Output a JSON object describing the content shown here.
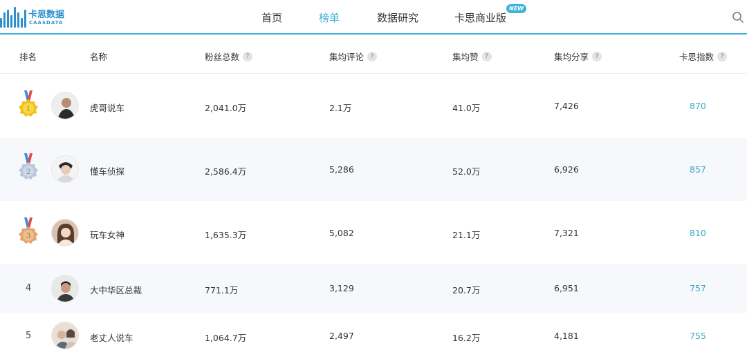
{
  "brand": {
    "name_cn": "卡思数据",
    "name_en": "CAASDATA",
    "color": "#2b8fd0"
  },
  "nav": {
    "items": [
      {
        "label": "首页",
        "active": false
      },
      {
        "label": "榜单",
        "active": true
      },
      {
        "label": "数据研究",
        "active": false
      },
      {
        "label": "卡思商业版",
        "active": false
      }
    ],
    "new_badge": "NEW",
    "accent": "#3fb2d7"
  },
  "table": {
    "columns": [
      "排名",
      "名称",
      "粉丝总数",
      "集均评论",
      "集均赞",
      "集均分享",
      "卡思指数"
    ],
    "help_icon": "?",
    "rows": [
      {
        "rank": "1",
        "medal": "gold",
        "name": "虎哥说车",
        "fans": "2,041.0万",
        "comments": "2.1万",
        "likes": "41.0万",
        "shares": "7,426",
        "index": "870"
      },
      {
        "rank": "2",
        "medal": "silver",
        "name": "懂车侦探",
        "fans": "2,586.4万",
        "comments": "5,286",
        "likes": "52.0万",
        "shares": "6,926",
        "index": "857"
      },
      {
        "rank": "3",
        "medal": "bronze",
        "name": "玩车女神",
        "fans": "1,635.3万",
        "comments": "5,082",
        "likes": "21.1万",
        "shares": "7,321",
        "index": "810"
      },
      {
        "rank": "4",
        "medal": "",
        "name": "大中华区总裁",
        "fans": "771.1万",
        "comments": "3,129",
        "likes": "20.7万",
        "shares": "6,951",
        "index": "757"
      },
      {
        "rank": "5",
        "medal": "",
        "name": "老丈人说车",
        "fans": "1,064.7万",
        "comments": "2,497",
        "likes": "16.2万",
        "shares": "4,181",
        "index": "755"
      }
    ]
  }
}
